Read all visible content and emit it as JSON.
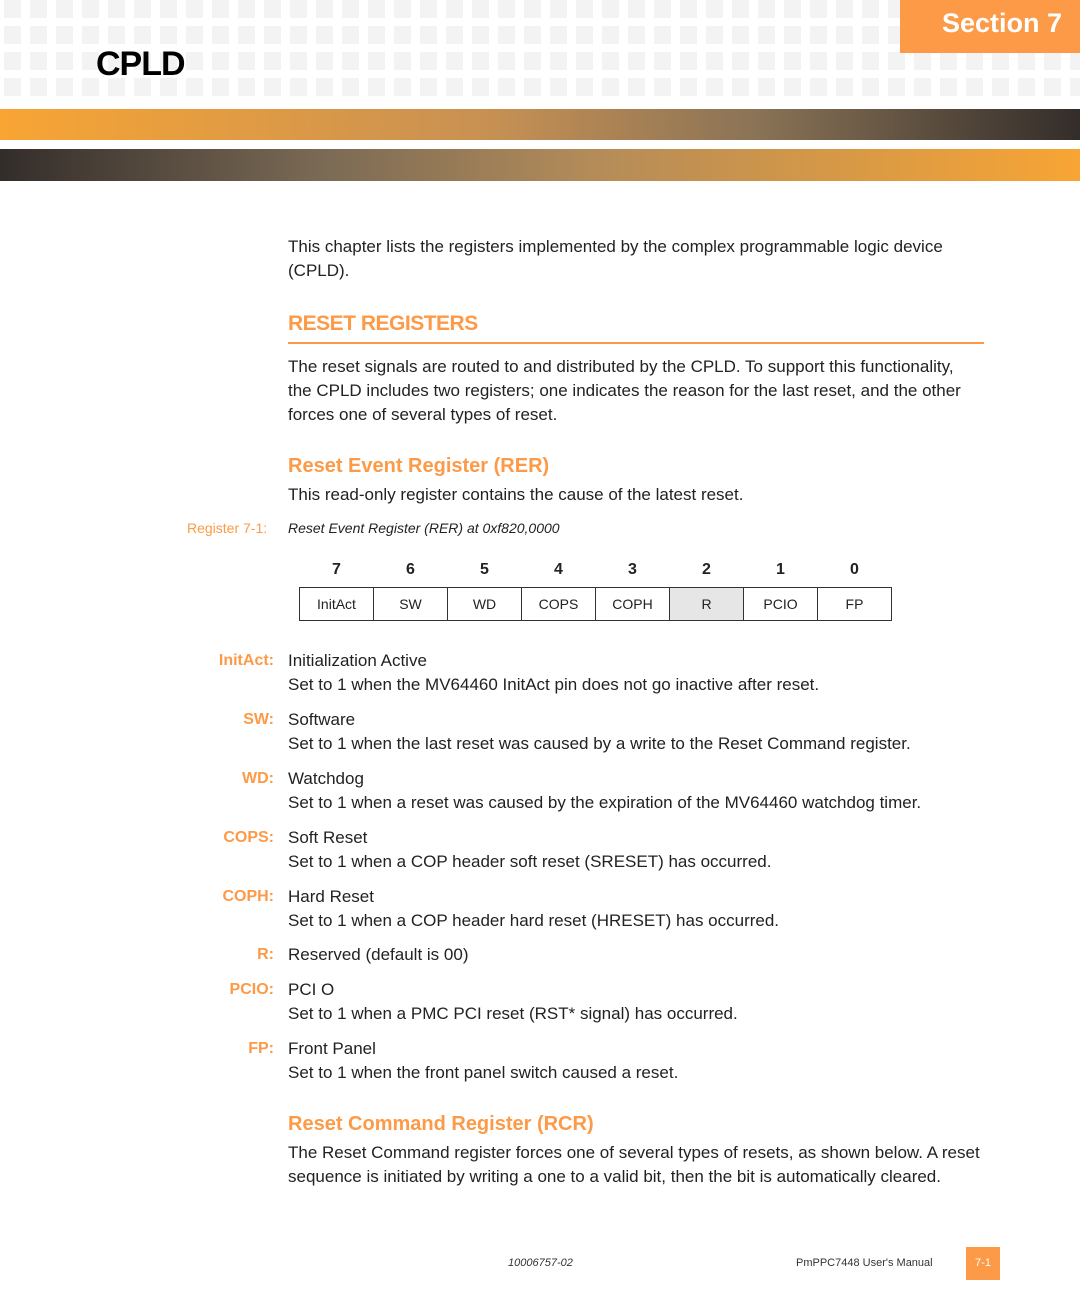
{
  "header": {
    "section_label": "Section 7",
    "chapter_title": "CPLD"
  },
  "intro": "This chapter lists the registers implemented by the complex programmable logic device (CPLD).",
  "reset_registers": {
    "heading": "RESET REGISTERS",
    "body": "The reset signals are routed to and distributed by the CPLD. To support this functionality, the CPLD includes two registers; one indicates the reason for the last reset, and the other forces one of several types of reset."
  },
  "rer": {
    "heading": "Reset Event Register (RER)",
    "body": "This read-only register contains the cause of the latest reset.",
    "caption_label": "Register 7-1:",
    "caption_text": "Reset Event Register (RER) at 0xf820,0000",
    "bits": [
      "7",
      "6",
      "5",
      "4",
      "3",
      "2",
      "1",
      "0"
    ],
    "fields": [
      "InitAct",
      "SW",
      "WD",
      "COPS",
      "COPH",
      "R",
      "PCIO",
      "FP"
    ],
    "reserved_field": "R",
    "definitions": [
      {
        "term": "InitAct:",
        "name": "Initialization Active",
        "desc": "Set to 1 when the MV64460 InitAct pin does not go inactive after reset."
      },
      {
        "term": "SW:",
        "name": "Software",
        "desc": "Set to 1 when the last reset was caused by a write to the Reset Command register."
      },
      {
        "term": "WD:",
        "name": "Watchdog",
        "desc": "Set to 1 when a reset was caused by the expiration of the MV64460 watchdog timer."
      },
      {
        "term": "COPS:",
        "name": "Soft Reset",
        "desc": "Set to 1 when a COP header soft reset (SRESET) has occurred."
      },
      {
        "term": "COPH:",
        "name": "Hard Reset",
        "desc": "Set to 1 when a COP header hard reset (HRESET) has occurred."
      },
      {
        "term": "R:",
        "name": "Reserved (default is 00)",
        "desc": ""
      },
      {
        "term": "PCIO:",
        "name": "PCI O",
        "desc": "Set to 1 when a PMC PCI reset (RST* signal) has occurred."
      },
      {
        "term": "FP:",
        "name": "Front Panel",
        "desc": "Set to 1 when the front panel switch caused a reset."
      }
    ]
  },
  "rcr": {
    "heading": "Reset Command Register (RCR)",
    "body": "The Reset Command register forces one of several types of resets, as shown below. A reset sequence is initiated by writing a one to a valid bit, then the bit is automatically cleared."
  },
  "footer": {
    "doc_number": "10006757-02",
    "manual_title": "PmPPC7448 User's Manual",
    "page": "7-1"
  },
  "colors": {
    "accent": "#fd9a47"
  }
}
